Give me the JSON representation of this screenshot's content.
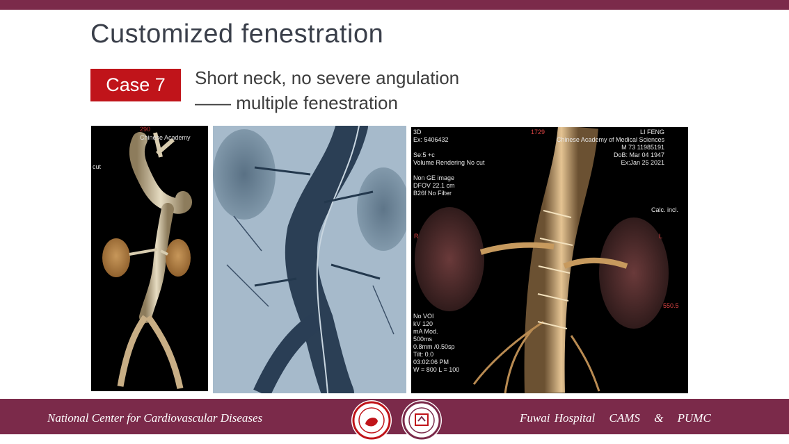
{
  "slide": {
    "title": "Customized fenestration",
    "case_label": "Case 7",
    "subtitle_line1": "Short neck, no severe angulation",
    "subtitle_line2": "—— multiple fenestration"
  },
  "panel1": {
    "label_top": "Chinese Academy",
    "label_left": "cut",
    "label_top_num": "290"
  },
  "panel3": {
    "left_top": [
      "3D",
      "Ex: 5406432",
      "",
      "Se:5 +c",
      "Volume Rendering No cut",
      "",
      "Non GE image",
      "DFOV 22.1 cm",
      "B26f No Filter"
    ],
    "right_top": [
      "LI FENG",
      "Chinese Academy of Medical Sciences",
      "M 73 11985191",
      "DoB: Mar 04 1947",
      "Ex:Jan 25 2021"
    ],
    "top_center": "1729",
    "calc": "Calc. incl.",
    "R": "R",
    "L": "L",
    "right_num": "550.5",
    "left_bottom": [
      "No VOI",
      "kV 120",
      "mA Mod.",
      "500ms",
      "0.8mm /0.50sp",
      "Tilt: 0.0",
      "03:02:06 PM",
      "W = 800 L = 100"
    ]
  },
  "footer": {
    "left": "National Center for Cardiovascular Diseases",
    "right_1": "Fuwai Hospital",
    "right_2": "CAMS",
    "right_3": "&",
    "right_4": "PUMC"
  },
  "colors": {
    "brand_bar": "#7b2a4a",
    "case_badge": "#c0141a"
  }
}
